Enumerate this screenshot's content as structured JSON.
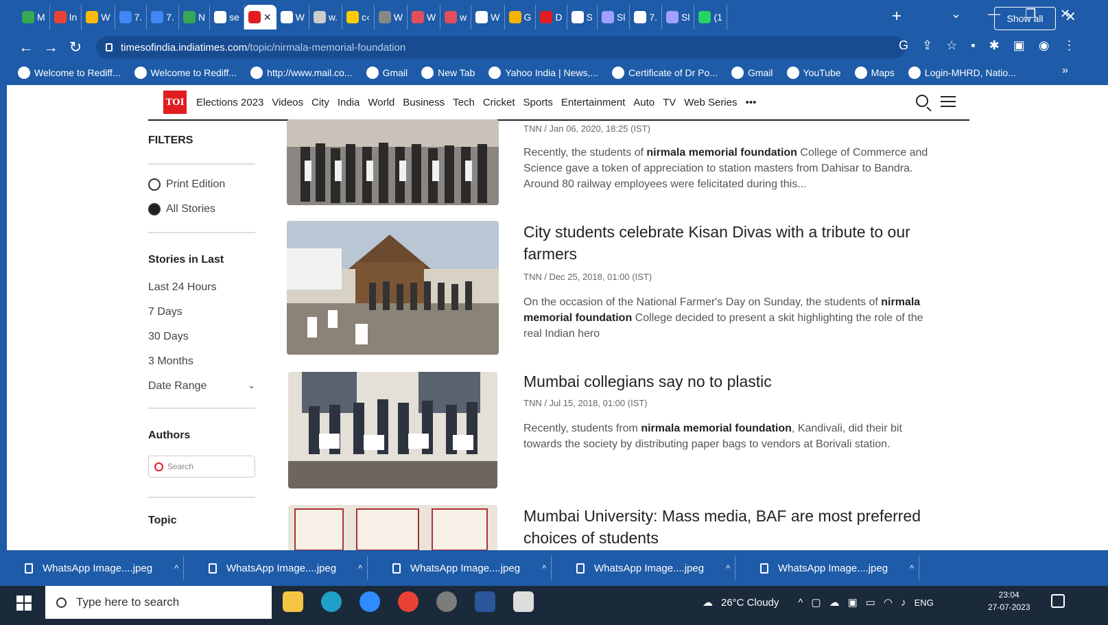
{
  "browser": {
    "tabs": [
      {
        "letter": "M",
        "color": "#34a853"
      },
      {
        "letter": "In",
        "color": "#ea4335"
      },
      {
        "letter": "W",
        "color": "#fbbc05"
      },
      {
        "letter": "7.",
        "color": "#4285f4"
      },
      {
        "letter": "7.",
        "color": "#4285f4"
      },
      {
        "letter": "N",
        "color": "#34a853"
      },
      {
        "letter": "se",
        "color": "#ffffff"
      },
      {
        "letter": "✕",
        "color": "#e11d21"
      },
      {
        "letter": "W",
        "color": "#ffffff"
      },
      {
        "letter": "w.",
        "color": "#cccccc"
      },
      {
        "letter": "c‹",
        "color": "#ffcc00"
      },
      {
        "letter": "W",
        "color": "#888888"
      },
      {
        "letter": "W",
        "color": "#e44d5a"
      },
      {
        "letter": "w",
        "color": "#e44d5a"
      },
      {
        "letter": "W",
        "color": "#ffffff"
      },
      {
        "letter": "G",
        "color": "#f4b400"
      },
      {
        "letter": "D",
        "color": "#e11d21"
      },
      {
        "letter": "S",
        "color": "#ffffff"
      },
      {
        "letter": "Sl",
        "color": "#a0a0ff"
      },
      {
        "letter": "7.",
        "color": "#ffffff"
      },
      {
        "letter": "Sl",
        "color": "#a0a0ff"
      },
      {
        "letter": "(1",
        "color": "#25d366"
      }
    ],
    "address": {
      "host": "timesofindia.indiatimes.com",
      "path": "/topic/nirmala-memorial-foundation"
    },
    "bookmarks": [
      "Welcome to Rediff...",
      "Welcome to Rediff...",
      "http://www.mail.co...",
      "Gmail",
      "New Tab",
      "Yahoo India | News,...",
      "Certificate of Dr Po...",
      "Gmail",
      "YouTube",
      "Maps",
      "Login-MHRD, Natio..."
    ]
  },
  "toi": {
    "logo": "TOI",
    "nav": [
      "Elections 2023",
      "Videos",
      "City",
      "India",
      "World",
      "Business",
      "Tech",
      "Cricket",
      "Sports",
      "Entertainment",
      "Auto",
      "TV",
      "Web Series",
      "•••"
    ]
  },
  "filters": {
    "title": "FILTERS",
    "edition_options": [
      "Print Edition",
      "All Stories"
    ],
    "stories_in_last_title": "Stories in Last",
    "time_options": [
      "Last 24 Hours",
      "7 Days",
      "30 Days",
      "3 Months",
      "Date Range"
    ],
    "authors_title": "Authors",
    "author_search_placeholder": "Search",
    "topic_title": "Topic"
  },
  "articles": [
    {
      "title": "",
      "meta": "TNN / Jan 06, 2020, 18:25 (IST)",
      "desc_pre": "Recently, the students of ",
      "desc_bold": "nirmala memorial foundation",
      "desc_post": " College of Commerce and Science gave a token of appreciation to station masters from Dahisar to Bandra. Around 80 railway employees were felicitated during this..."
    },
    {
      "title": "City students celebrate Kisan Divas with a tribute to our farmers",
      "meta": "TNN / Dec 25, 2018, 01:00 (IST)",
      "desc_pre": "On the occasion of the National Farmer's Day on Sunday, the students of ",
      "desc_bold": "nirmala memorial foundation",
      "desc_post": " College decided to present a skit highlighting the role of the real Indian hero"
    },
    {
      "title": "Mumbai collegians say no to plastic",
      "meta": "TNN / Jul 15, 2018, 01:00 (IST)",
      "desc_pre": "Recently, students from ",
      "desc_bold": "nirmala memorial foundation",
      "desc_post": ", Kandivali, did their bit towards the society by distributing paper bags to vendors at Borivali station."
    },
    {
      "title": "Mumbai University: Mass media, BAF are most preferred choices of students",
      "meta": "",
      "desc_pre": "",
      "desc_bold": "",
      "desc_post": ""
    }
  ],
  "downloads": {
    "items": [
      "WhatsApp Image....jpeg",
      "WhatsApp Image....jpeg",
      "WhatsApp Image....jpeg",
      "WhatsApp Image....jpeg",
      "WhatsApp Image....jpeg"
    ],
    "show_all": "Show all"
  },
  "taskbar": {
    "search_placeholder": "Type here to search",
    "weather": "26°C  Cloudy",
    "lang": "ENG",
    "time": "23:04",
    "date": "27-07-2023"
  },
  "colors": {
    "accent": "#1e5ba8",
    "toi_red": "#e11d21"
  }
}
